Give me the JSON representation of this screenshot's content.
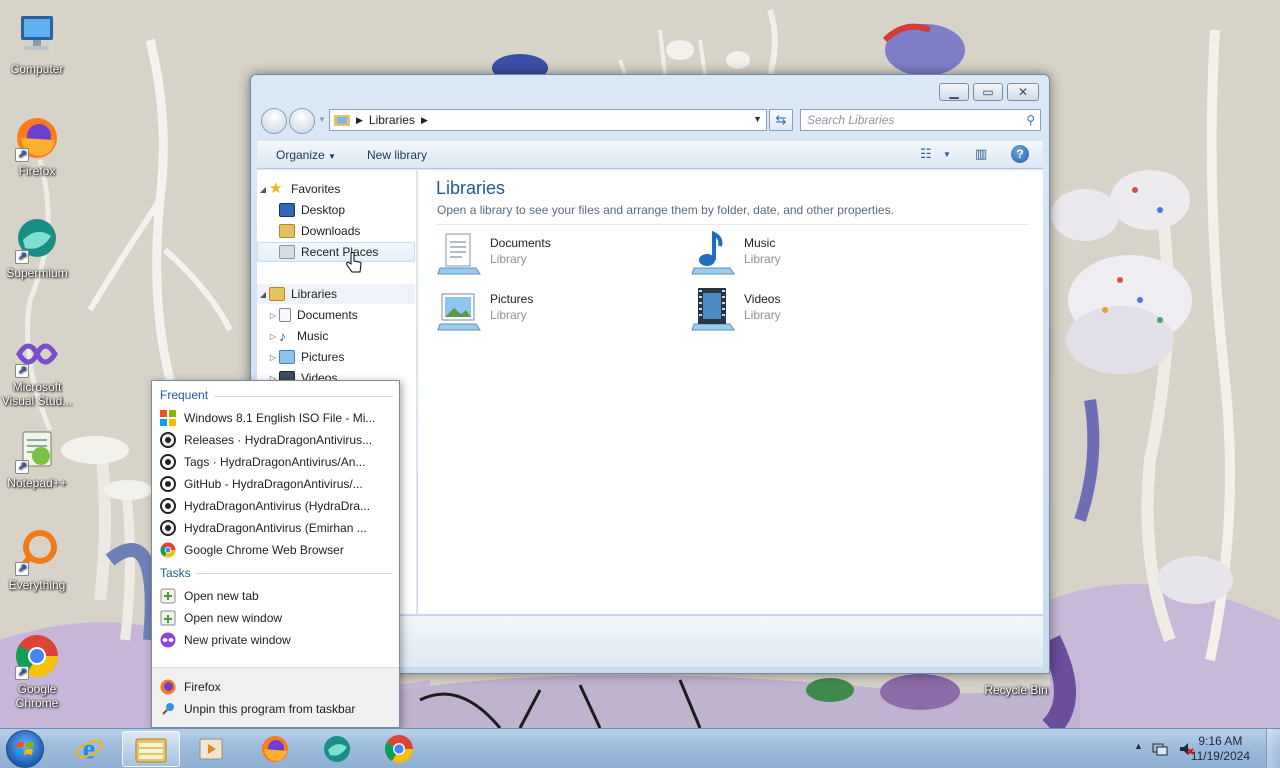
{
  "desktop": {
    "icons": [
      {
        "label": "Computer",
        "icon": "computer-icon"
      },
      {
        "label": "Firefox",
        "icon": "firefox-icon"
      },
      {
        "label": "Supermium",
        "icon": "supermium-icon"
      },
      {
        "label": "Microsoft Visual Stud...",
        "icon": "visual-studio-icon"
      },
      {
        "label": "Notepad++",
        "icon": "notepadpp-icon"
      },
      {
        "label": "Everything",
        "icon": "everything-icon"
      },
      {
        "label": "Google Chrome",
        "icon": "chrome-icon"
      },
      {
        "label": "Recycle Bin",
        "icon": "recycle-bin-icon"
      }
    ]
  },
  "explorer": {
    "address": {
      "segment": "Libraries"
    },
    "search": {
      "placeholder": "Search Libraries"
    },
    "toolbar": {
      "organize": "Organize",
      "new_library": "New library"
    },
    "nav": {
      "favorites": "Favorites",
      "desktop": "Desktop",
      "downloads": "Downloads",
      "recent_places": "Recent Places",
      "libraries": "Libraries",
      "documents": "Documents",
      "music": "Music",
      "pictures": "Pictures",
      "videos": "Videos"
    },
    "content": {
      "title": "Libraries",
      "subtitle": "Open a library to see your files and arrange them by folder, date, and other properties.",
      "libraries": [
        {
          "name": "Documents",
          "type": "Library"
        },
        {
          "name": "Music",
          "type": "Library"
        },
        {
          "name": "Pictures",
          "type": "Library"
        },
        {
          "name": "Videos",
          "type": "Library"
        }
      ]
    }
  },
  "jumplist": {
    "frequent_header": "Frequent",
    "frequent": [
      {
        "label": "Windows 8.1 English ISO File - Mi...",
        "icon": "microsoft-icon"
      },
      {
        "label": "Releases · HydraDragonAntivirus...",
        "icon": "github-icon"
      },
      {
        "label": "Tags · HydraDragonAntivirus/An...",
        "icon": "github-icon"
      },
      {
        "label": "GitHub - HydraDragonAntivirus/...",
        "icon": "github-icon"
      },
      {
        "label": "HydraDragonAntivirus (HydraDra...",
        "icon": "github-icon"
      },
      {
        "label": "HydraDragonAntivirus (Emirhan ...",
        "icon": "github-icon"
      },
      {
        "label": "Google Chrome Web Browser",
        "icon": "chrome-icon"
      }
    ],
    "tasks_header": "Tasks",
    "tasks": [
      {
        "label": "Open new tab",
        "icon": "new-tab-icon"
      },
      {
        "label": "Open new window",
        "icon": "new-window-icon"
      },
      {
        "label": "New private window",
        "icon": "private-window-icon"
      }
    ],
    "app": "Firefox",
    "unpin": "Unpin this program from taskbar"
  },
  "taskbar": {
    "clock_time": "9:16 AM",
    "clock_date": "11/19/2024"
  }
}
